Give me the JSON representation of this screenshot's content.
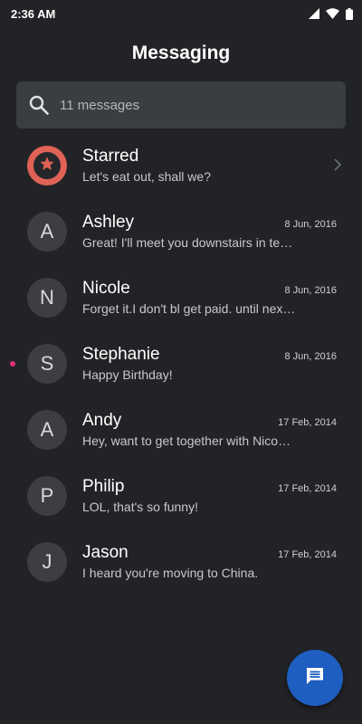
{
  "status_bar": {
    "time": "2:36 AM",
    "icons": [
      "signal-icon",
      "wifi-icon",
      "battery-icon"
    ]
  },
  "app": {
    "title": "Messaging"
  },
  "search": {
    "icon": "search-icon",
    "placeholder": "11 messages"
  },
  "conversations": [
    {
      "name": "Starred",
      "snippet": "Let's eat out, shall we?",
      "date": "",
      "avatar": "star-icon",
      "unread": false
    },
    {
      "name": "Ashley",
      "snippet": "Great! I'll meet you downstairs in te…",
      "date": "8 Jun, 2016",
      "avatar": "A",
      "unread": false
    },
    {
      "name": "Nicole",
      "snippet": "Forget it.I don't bl get paid. until nex…",
      "date": "8 Jun, 2016",
      "avatar": "N",
      "unread": false
    },
    {
      "name": "Stephanie",
      "snippet": "Happy Birthday!",
      "date": "8 Jun, 2016",
      "avatar": "S",
      "unread": true
    },
    {
      "name": "Andy",
      "snippet": "Hey, want to get together with Nico…",
      "date": "17 Feb, 2014",
      "avatar": "A",
      "unread": false
    },
    {
      "name": "Philip",
      "snippet": "LOL, that's so funny!",
      "date": "17 Feb, 2014",
      "avatar": "P",
      "unread": false
    },
    {
      "name": "Jason",
      "snippet": "I heard you're moving to China.",
      "date": "17 Feb, 2014",
      "avatar": "J",
      "unread": false
    }
  ],
  "fab": {
    "icon": "compose-message-icon"
  },
  "colors": {
    "background": "#222326",
    "search_bg": "#3a3d42",
    "avatar_bg": "#3c3e42",
    "starred_accent": "#e06256",
    "unread_dot": "#e0307a",
    "fab": "#1e5ec0"
  }
}
